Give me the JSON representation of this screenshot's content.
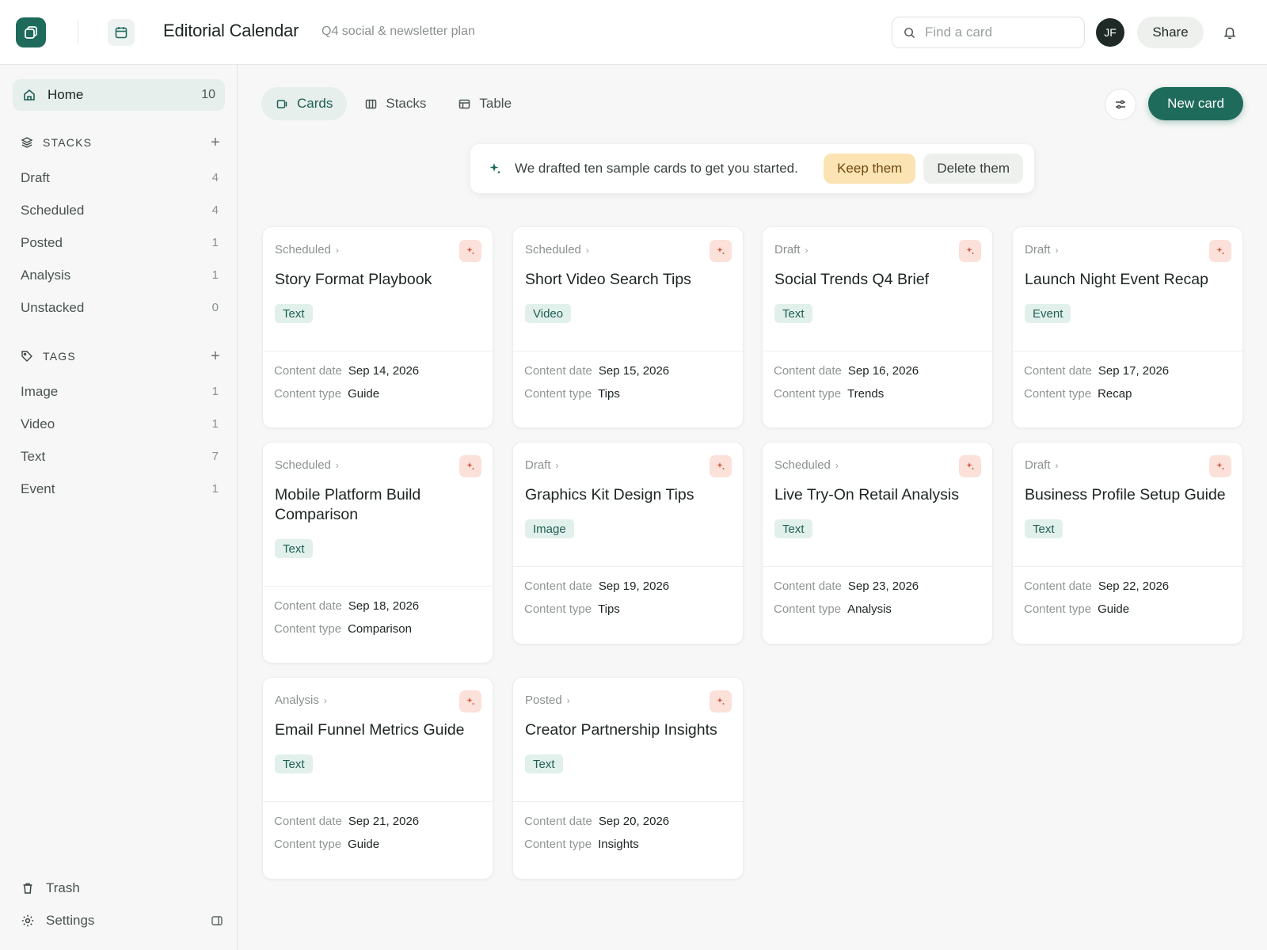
{
  "header": {
    "title": "Editorial Calendar",
    "subtitle": "Q4 social & newsletter plan",
    "search_placeholder": "Find a card",
    "avatar_initials": "JF",
    "share_label": "Share"
  },
  "sidebar": {
    "home": {
      "label": "Home",
      "count": "10"
    },
    "stacks_heading": "STACKS",
    "stacks": [
      {
        "label": "Draft",
        "count": "4"
      },
      {
        "label": "Scheduled",
        "count": "4"
      },
      {
        "label": "Posted",
        "count": "1"
      },
      {
        "label": "Analysis",
        "count": "1"
      },
      {
        "label": "Unstacked",
        "count": "0"
      }
    ],
    "tags_heading": "TAGS",
    "tags": [
      {
        "label": "Image",
        "count": "1"
      },
      {
        "label": "Video",
        "count": "1"
      },
      {
        "label": "Text",
        "count": "7"
      },
      {
        "label": "Event",
        "count": "1"
      }
    ],
    "trash_label": "Trash",
    "settings_label": "Settings"
  },
  "views": {
    "tabs": [
      {
        "label": "Cards",
        "active": true
      },
      {
        "label": "Stacks",
        "active": false
      },
      {
        "label": "Table",
        "active": false
      }
    ],
    "new_card_label": "New card"
  },
  "notice": {
    "message": "We drafted ten sample cards to get you started.",
    "keep_label": "Keep them",
    "delete_label": "Delete them"
  },
  "card_labels": {
    "date": "Content date",
    "type": "Content type"
  },
  "cards": [
    {
      "stack": "Scheduled",
      "title": "Story Format Playbook",
      "tag": "Text",
      "date": "Sep 14, 2026",
      "type": "Guide"
    },
    {
      "stack": "Scheduled",
      "title": "Short Video Search Tips",
      "tag": "Video",
      "date": "Sep 15, 2026",
      "type": "Tips"
    },
    {
      "stack": "Draft",
      "title": "Social Trends Q4 Brief",
      "tag": "Text",
      "date": "Sep 16, 2026",
      "type": "Trends"
    },
    {
      "stack": "Draft",
      "title": "Launch Night Event Recap",
      "tag": "Event",
      "date": "Sep 17, 2026",
      "type": "Recap"
    },
    {
      "stack": "Scheduled",
      "title": "Mobile Platform Build Comparison",
      "tag": "Text",
      "date": "Sep 18, 2026",
      "type": "Comparison"
    },
    {
      "stack": "Draft",
      "title": "Graphics Kit Design Tips",
      "tag": "Image",
      "date": "Sep 19, 2026",
      "type": "Tips"
    },
    {
      "stack": "Scheduled",
      "title": "Live Try-On Retail Analysis",
      "tag": "Text",
      "date": "Sep 23, 2026",
      "type": "Analysis"
    },
    {
      "stack": "Draft",
      "title": "Business Profile Setup Guide",
      "tag": "Text",
      "date": "Sep 22, 2026",
      "type": "Guide"
    },
    {
      "stack": "Analysis",
      "title": "Email Funnel Metrics Guide",
      "tag": "Text",
      "date": "Sep 21, 2026",
      "type": "Guide"
    },
    {
      "stack": "Posted",
      "title": "Creator Partnership Insights",
      "tag": "Text",
      "date": "Sep 20, 2026",
      "type": "Insights"
    }
  ]
}
